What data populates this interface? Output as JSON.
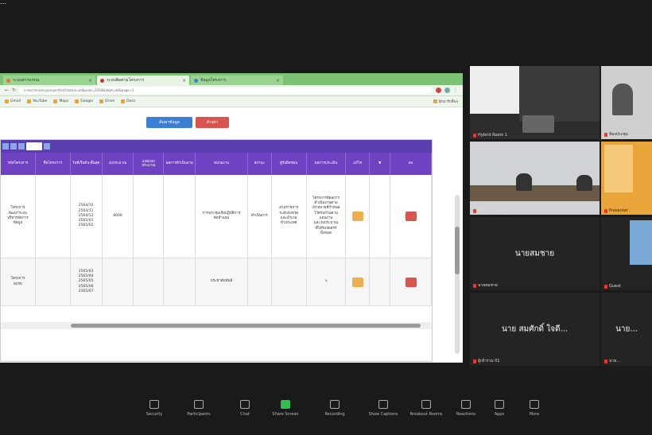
{
  "corner_glyph": "⋯",
  "browser": {
    "tabs": [
      {
        "label": "ระบบสารบรรณ"
      },
      {
        "label": "ระบบติดตามโครงการ"
      },
      {
        "label": "ข้อมูลโครงการ"
      }
    ],
    "url": "e-doc/ministry/project/list?status=all&year=2564&dept=all&page=1",
    "bookmarks": [
      "Gmail",
      "YouTube",
      "Maps",
      "Google",
      "Drive",
      "Docs",
      "บุ๊กมาร์กอื่นๆ"
    ]
  },
  "page": {
    "primary_button": "ค้นหาข้อมูล",
    "danger_button": "ล้างค่า",
    "table": {
      "headers": [
        "รหัสโครงการ",
        "ชื่อโครงการ",
        "วันที่เริ่มต้น-สิ้นสุด",
        "งบประมาณ",
        "แหล่งงบประมาณ",
        "ผลการดำเนินงาน",
        "หน่วยงาน",
        "สถานะ",
        "ผู้รับผิดชอบ",
        "ผลการประเมิน",
        "แก้ไข",
        "▼",
        "ลบ"
      ],
      "rows": [
        {
          "cells": [
            "โครงการ\nพัฒนาระบบ\nบริหารจัดการ\nข้อมูล",
            "",
            "2564/10\n2564/11\n2564/12\n2565/01\n2565/02",
            "8000",
            "",
            "",
            "การประชุมเชิงปฏิบัติการ\nจัดทำแผน",
            "ดำเนินการ",
            "ส่วนราชการ\nระดับจังหวัด\nและอำเภอ\nทั่วประเทศ",
            "โครงการมีผลการ\nดำเนินงานตาม\nเป้าหมายที่กำหนด\nไว้ครบถ้วนตาม\nแผนงาน\nและงบประมาณ\nที่ได้รับจัดสรร\nทั้งหมด",
            "",
            "",
            ""
          ]
        },
        {
          "cells": [
            "โครงการ\nอบรม",
            "",
            "2565/03\n2565/04\n2565/05\n2565/06\n2565/07",
            "",
            "",
            "",
            "ประชาสัมพันธ์",
            "",
            "",
            "↘",
            "",
            "",
            ""
          ]
        }
      ]
    }
  },
  "participants": [
    {
      "name": "Hybrid Room 1",
      "kind": "video"
    },
    {
      "name": "ห้องประชุม",
      "kind": "video"
    },
    {
      "name": "Meeting Room",
      "kind": "video"
    },
    {
      "name": "Presenter",
      "kind": "video"
    },
    {
      "name": "นายสมชาย",
      "display": "นายสมชาย",
      "kind": "name"
    },
    {
      "name": "Guest",
      "kind": "video"
    },
    {
      "name": "ผู้เข้าร่วม 01",
      "display": "นาย สมศักดิ์ ใจดี...",
      "kind": "name"
    },
    {
      "name": "นาย...",
      "display": "นาย...",
      "kind": "name"
    }
  ],
  "toolbar": {
    "items": [
      {
        "label": "Security"
      },
      {
        "label": "Participants"
      },
      {
        "label": "Chat"
      },
      {
        "label": "Share Screen"
      },
      {
        "label": "Recording"
      },
      {
        "label": "Show Captions"
      },
      {
        "label": "Breakout Rooms"
      },
      {
        "label": "Reactions"
      },
      {
        "label": "Apps"
      },
      {
        "label": "More"
      }
    ]
  },
  "colors": {
    "tab_bar": "#7cc274",
    "table_header": "#6f42c1",
    "pager": "#5a3fb0",
    "primary": "#3b7fd4",
    "danger": "#d9534f",
    "edit": "#f0ad4e",
    "share_active": "#2fbf4a"
  }
}
